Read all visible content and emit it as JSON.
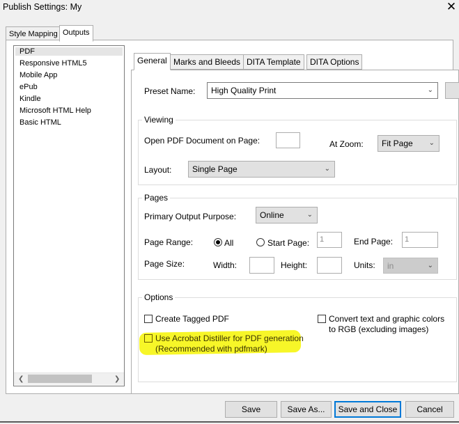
{
  "window": {
    "title": "Publish Settings: My",
    "close_glyph": "✕"
  },
  "top_tabs": [
    {
      "label": "Style Mapping"
    },
    {
      "label": "Outputs"
    }
  ],
  "outputs_list": [
    "PDF",
    "Responsive HTML5",
    "Mobile App",
    "ePub",
    "Kindle",
    "Microsoft HTML Help",
    "Basic HTML"
  ],
  "inner_tabs": [
    {
      "label": "General"
    },
    {
      "label": "Marks and Bleeds"
    },
    {
      "label": "DITA Template"
    },
    {
      "label": "DITA Options"
    }
  ],
  "general": {
    "preset_label": "Preset Name:",
    "preset_value": "High Quality Print",
    "viewing": {
      "title": "Viewing",
      "open_on_page_label": "Open PDF Document on Page:",
      "open_on_page_value": "",
      "at_zoom_label": "At Zoom:",
      "at_zoom_value": "Fit Page",
      "layout_label": "Layout:",
      "layout_value": "Single Page"
    },
    "pages": {
      "title": "Pages",
      "purpose_label": "Primary Output Purpose:",
      "purpose_value": "Online",
      "range_label": "Page Range:",
      "range_all": "All",
      "range_start": "Start Page:",
      "start_value": "1",
      "end_label": "End Page:",
      "end_value": "1",
      "size_label": "Page Size:",
      "width_label": "Width:",
      "height_label": "Height:",
      "units_label": "Units:",
      "units_value": "in"
    },
    "options": {
      "title": "Options",
      "tagged_pdf": "Create Tagged PDF",
      "convert_line1": "Convert text and graphic colors",
      "convert_line2": "to RGB (excluding images)",
      "distiller_line1": "Use Acrobat Distiller for PDF generation",
      "distiller_line2": "(Recommended with pdfmark)"
    }
  },
  "buttons": {
    "save": "Save",
    "save_as": "Save As...",
    "save_close": "Save and Close",
    "cancel": "Cancel"
  },
  "highlight_color": "#f7f51c",
  "accent_color": "#0078d7"
}
